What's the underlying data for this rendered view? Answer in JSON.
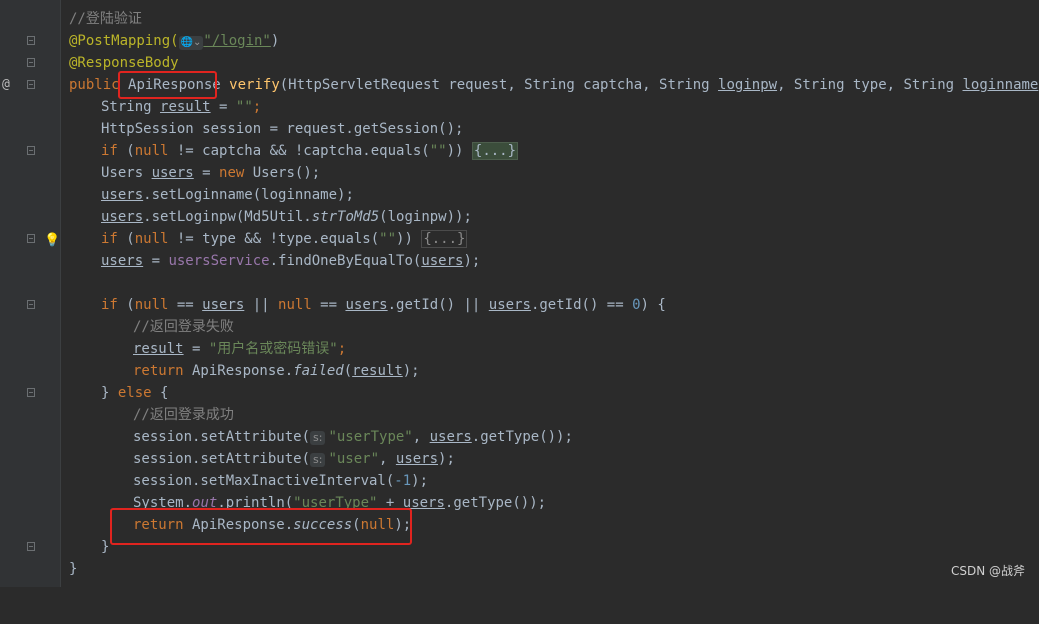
{
  "gutter": {
    "override_marker": "@"
  },
  "lines": {
    "l1": {
      "comment": "//登陆验证"
    },
    "l2": {
      "annotation": "@PostMapping(",
      "hint_globe": "🌐⌄",
      "path": "\"/login\"",
      "close": ")"
    },
    "l3": {
      "annotation": "@ResponseBody"
    },
    "l4": {
      "kw_public": "public ",
      "return_type": "ApiResponse",
      "method": "verify",
      "params_a": "(HttpServletRequest request, String captcha, String ",
      "p_loginpw": "loginpw",
      "params_b": ", String type, String ",
      "p_loginname": "loginname",
      "params_c": ") {"
    },
    "l5": {
      "t1": "String ",
      "v": "result",
      "t2": " = ",
      "s": "\"\"",
      "t3": ";"
    },
    "l6": {
      "t1": "HttpSession session = request.getSession();"
    },
    "l7": {
      "kw_if": "if",
      "t1": " (",
      "kw_null": "null",
      "t2": " != captcha && !captcha.equals(",
      "s": "\"\"",
      "t3": ")) ",
      "folded": "{...}"
    },
    "l8": {
      "t1": "Users ",
      "v": "users",
      "t2": " = ",
      "kw_new": "new",
      "t3": " Users();"
    },
    "l9": {
      "v": "users",
      "t1": ".setLoginname(loginname);"
    },
    "l10": {
      "v": "users",
      "t1": ".setLoginpw(Md5Util.",
      "f": "strToMd5",
      "t2": "(loginpw));"
    },
    "l11": {
      "kw_if": "if",
      "t1": " (",
      "kw_null": "null",
      "t2": " != type && !type.equals(",
      "s": "\"\"",
      "t3": ")) ",
      "folded": "{...}"
    },
    "l12": {
      "v": "users",
      "t1": " = ",
      "field": "usersService",
      "t2": ".findOneByEqualTo(",
      "v2": "users",
      "t3": ");"
    },
    "l14": {
      "kw_if": "if",
      "t1": " (",
      "kw_null1": "null",
      "t2": " == ",
      "v1": "users",
      "t3": " || ",
      "kw_null2": "null",
      "t4": " == ",
      "v2": "users",
      "t5": ".getId() || ",
      "v3": "users",
      "t6": ".getId() == ",
      "n": "0",
      "t7": ") {"
    },
    "l15": {
      "comment": "//返回登录失败"
    },
    "l16": {
      "v": "result",
      "t1": " = ",
      "s": "\"用户名或密码错误\"",
      "t2": ";"
    },
    "l17": {
      "kw_return": "return",
      "t1": " ApiResponse.",
      "f": "failed",
      "t2": "(",
      "v": "result",
      "t3": ");"
    },
    "l18": {
      "t1": "} ",
      "kw_else": "else",
      "t2": " {"
    },
    "l19": {
      "comment": "//返回登录成功"
    },
    "l20": {
      "t1": "session.setAttribute(",
      "hint": "s:",
      "s": "\"userType\"",
      "t2": ", ",
      "v": "users",
      "t3": ".getType());"
    },
    "l21": {
      "t1": "session.setAttribute(",
      "hint": "s:",
      "s": "\"user\"",
      "t2": ", ",
      "v": "users",
      "t3": ");"
    },
    "l22": {
      "t1": "session.setMaxInactiveInterval(",
      "n": "-1",
      "t2": ");"
    },
    "l23": {
      "t1": "System.",
      "f": "out",
      "t2": ".println(",
      "s": "\"userType\"",
      "t3": " + ",
      "v": "users",
      "t4": ".getType());"
    },
    "l24": {
      "kw_return": "return",
      "t1": " ApiResponse.",
      "f": "success",
      "t2": "(",
      "kw_null": "null",
      "t3": ");"
    },
    "l25": {
      "t1": "}"
    },
    "l26": {
      "t1": "}"
    }
  },
  "watermark": "CSDN @战斧",
  "colors": {
    "background": "#2b2b2b",
    "keyword": "#cc7832",
    "string": "#6a8759",
    "annotation": "#bbb529",
    "highlight_box": "#e0241f"
  }
}
